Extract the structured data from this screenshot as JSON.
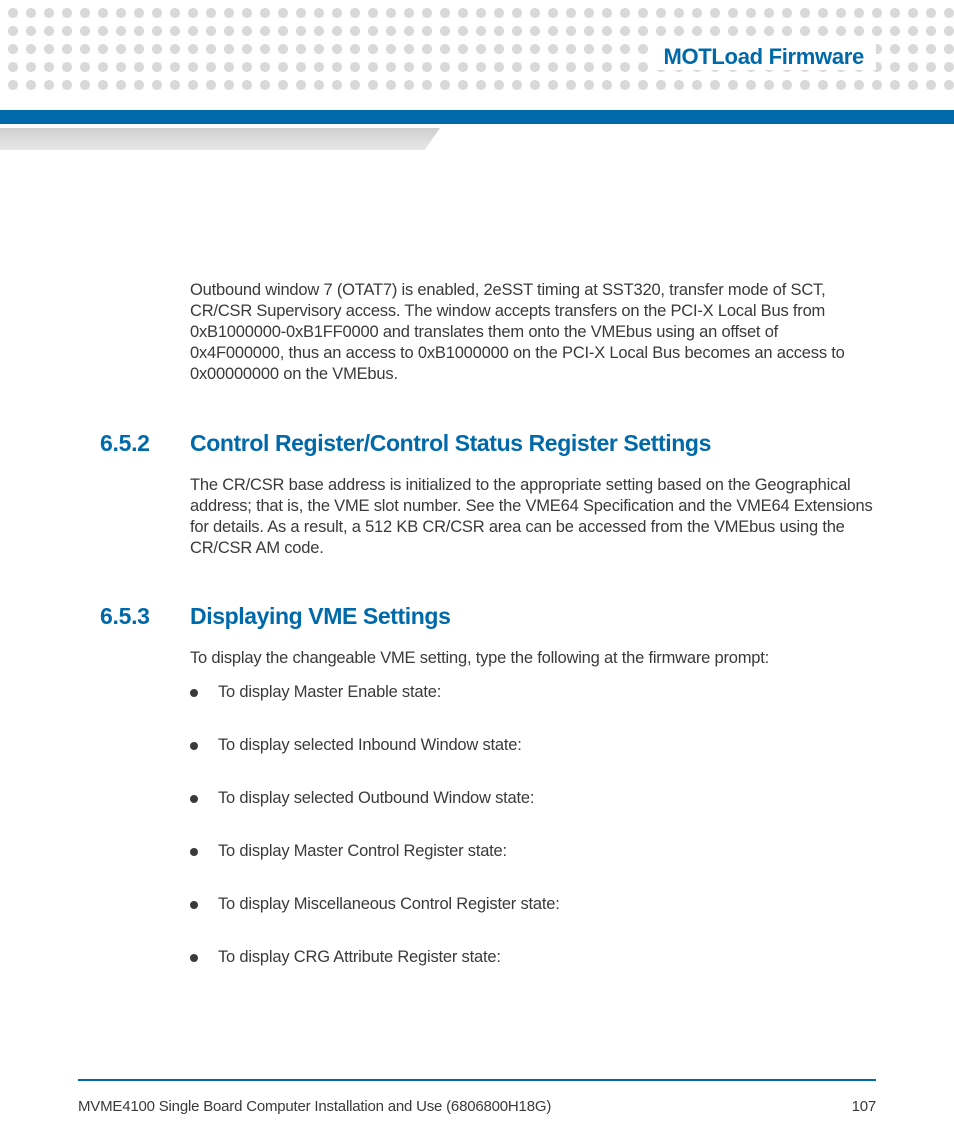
{
  "header": {
    "running_title": "MOTLoad Firmware"
  },
  "intro_paragraph": "Outbound window 7 (OTAT7) is enabled, 2eSST timing at SST320, transfer mode of SCT, CR/CSR Supervisory access. The window accepts transfers on the PCI-X Local Bus from 0xB1000000-0xB1FF0000 and translates them onto the VMEbus using an offset of 0x4F000000, thus an access to 0xB1000000 on the PCI-X Local Bus becomes an access to 0x00000000 on the VMEbus.",
  "sections": [
    {
      "number": "6.5.2",
      "title": "Control Register/Control Status Register Settings",
      "body": "The CR/CSR base address is initialized to the appropriate setting based on the Geographical address; that is, the VME slot number. See the VME64 Specification and the VME64 Extensions for details. As a result, a 512 KB CR/CSR area can be accessed from the VMEbus using the CR/CSR AM code."
    },
    {
      "number": "6.5.3",
      "title": "Displaying VME Settings",
      "body": "To display the changeable VME setting, type the following at the firmware prompt:",
      "bullets": [
        "To display Master Enable state:",
        "To display selected Inbound Window state:",
        "To display selected Outbound Window state:",
        "To display Master Control Register state:",
        "To display Miscellaneous Control Register state:",
        "To display CRG Attribute Register state:"
      ]
    }
  ],
  "footer": {
    "doc_title": "MVME4100 Single Board Computer Installation and Use (6806800H18G)",
    "page_number": "107"
  }
}
